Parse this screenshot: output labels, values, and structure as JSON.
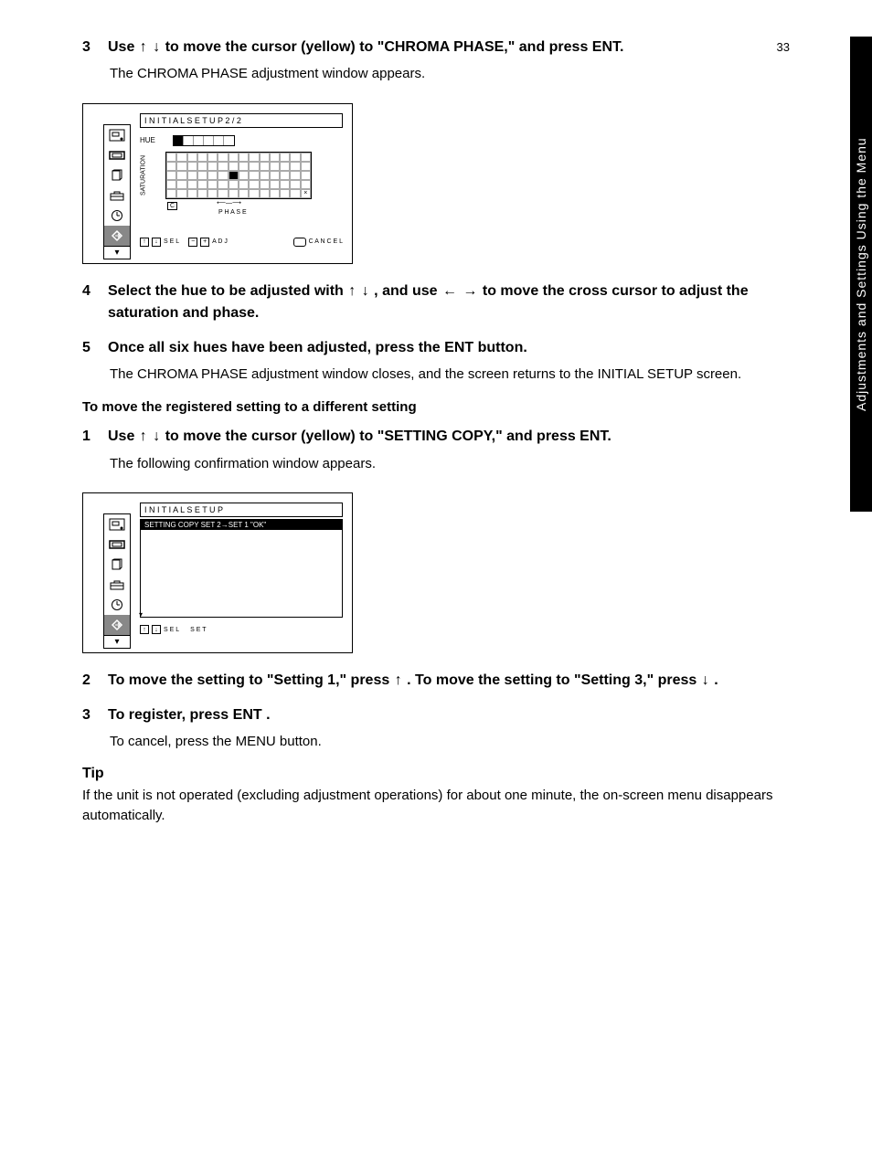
{
  "page_number": "33",
  "sidebar_tab": "Adjustments and Settings Using the Menu",
  "step3": {
    "num": "3",
    "text_before": "Use ",
    "text_after": " to move the cursor (yellow) to \"CHROMA PHASE,\" and press ENT."
  },
  "para1": "The CHROMA PHASE adjustment window appears.",
  "screenshot1": {
    "title": "I N I T I A L   S E T U P   2 / 2",
    "hue_label": "HUE",
    "sat_label": "SATURATION",
    "origin": "C",
    "phase_label": "P H A S E",
    "hint_sel": "S E L",
    "hint_adj": "A D J",
    "hint_cancel": "C A N C E L",
    "x_mark": "×"
  },
  "step4": {
    "num": "4",
    "text_a": "Select the hue to be adjusted with ",
    "text_b": ", and use ",
    "text_c": " to move the cross cursor to adjust the saturation and phase."
  },
  "step5": {
    "num": "5",
    "text": "Once all six hues have been adjusted, press the ENT button."
  },
  "para2": "The CHROMA PHASE adjustment window closes, and the screen returns to the INITIAL SETUP screen.",
  "section_header": "To move the registered setting to a different setting",
  "step_a1": {
    "num": "1",
    "text_before": "Use ",
    "text_after": " to move the cursor (yellow) to \"SETTING COPY,\" and press ENT."
  },
  "para3": "The following confirmation window appears.",
  "screenshot2": {
    "title": "I N I T I A L   S E T U P",
    "items": [
      "SETTING COPY SET 2→SET 1 \"OK\"",
      "",
      ""
    ],
    "hint_sel": "S E L",
    "hint_set": "S E T"
  },
  "step_a2": {
    "num": "2",
    "text_a": "To move the setting to \"Setting 1,\" press ",
    "text_b": ". To move the setting to \"Setting 3,\" press ",
    "text_c": "."
  },
  "step_a3": {
    "num": "3",
    "text_before": "To register, press ",
    "ent": "ENT",
    "text_after": "."
  },
  "para4": "To cancel, press the MENU button.",
  "tip_label": "Tip",
  "tip_text": "If the unit is not operated (excluding adjustment operations) for about one minute, the on-screen menu disappears automatically."
}
